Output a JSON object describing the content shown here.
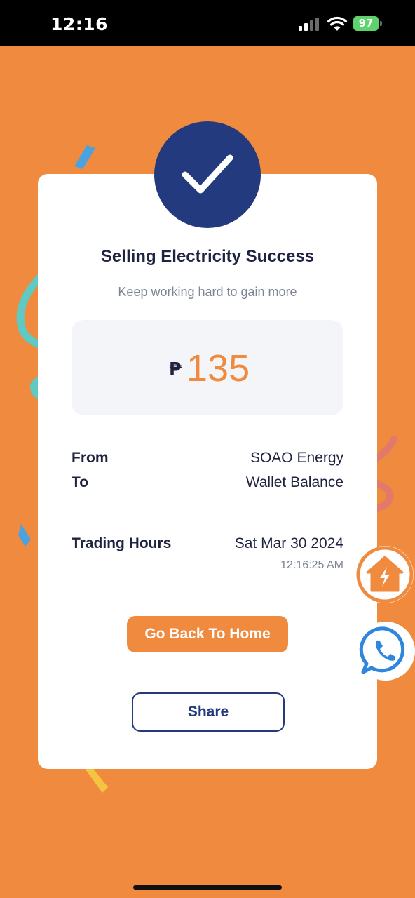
{
  "status_bar": {
    "time": "12:16",
    "battery": "97"
  },
  "card": {
    "title": "Selling Electricity Success",
    "subtitle": "Keep working hard to gain more",
    "currency_symbol": "₱",
    "amount": "135",
    "from_label": "From",
    "from_value": "SOAO Energy",
    "to_label": "To",
    "to_value": "Wallet Balance",
    "trading_hours_label": "Trading Hours",
    "trading_date": "Sat Mar 30 2024",
    "trading_time": "12:16:25 AM",
    "home_button": "Go Back To Home",
    "share_button": "Share"
  },
  "colors": {
    "background": "#ef8a3f",
    "primary_navy": "#233a7e",
    "accent_orange": "#ef8a3f"
  },
  "icons": [
    "check-icon",
    "home-energy-icon",
    "whatsapp-icon"
  ]
}
